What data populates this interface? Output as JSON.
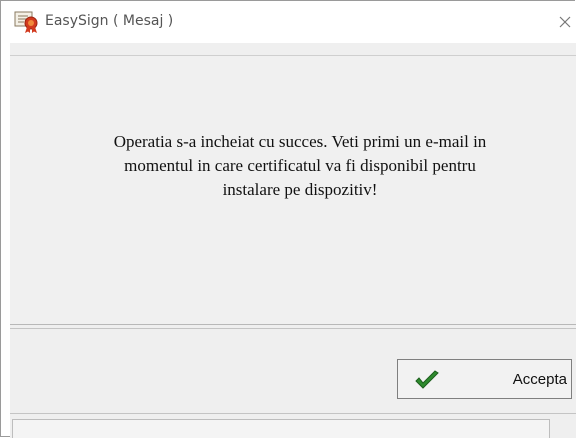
{
  "window": {
    "title": "EasySign ( Mesaj )",
    "close_symbol": "✕"
  },
  "message": {
    "lines": [
      "Operatia s-a incheiat cu succes. Veti primi un e-mail in",
      "momentul in care certificatul va fi disponibil pentru",
      "instalare pe dispozitiv!"
    ]
  },
  "buttons": {
    "accept_label": "Accepta"
  },
  "icons": {
    "app": "certificate-ribbon-icon",
    "close": "close-icon",
    "accept": "checkmark-icon"
  },
  "colors": {
    "checkmark": "#2e8b2e",
    "ribbon_red": "#d23a1e",
    "panel_bg": "#f0f0f0"
  }
}
